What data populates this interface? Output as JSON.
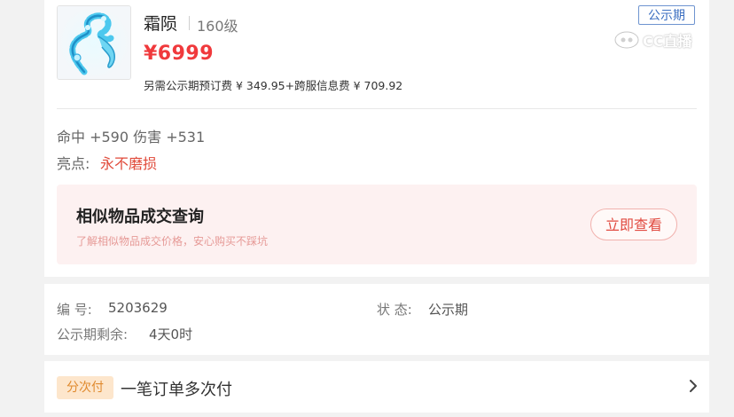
{
  "item": {
    "name": "霜陨",
    "level": "160级",
    "price": "¥6999",
    "fee_text": "另需公示期预订费 ¥ 349.95+跨服信息费 ¥ 709.92",
    "status_tag": "公示期",
    "stats": "命中 +590 伤害 +531",
    "highlight_label": "亮点:",
    "highlight_value": "永不磨损"
  },
  "similar": {
    "title": "相似物品成交查询",
    "subtitle": "了解相似物品成交价格，安心购买不踩坑",
    "button": "立即查看"
  },
  "info": {
    "id_label": "编 号:",
    "id_value": "5203629",
    "status_label": "状 态:",
    "status_value": "公示期",
    "remaining_label": "公示期剩余:",
    "remaining_value": "4天0时"
  },
  "payment": {
    "tag": "分次付",
    "text": "一笔订单多次付"
  },
  "watermark": {
    "text": "CC直播"
  },
  "colors": {
    "price": "#f0393c",
    "highlight": "#e04a3a",
    "status_tag": "#3c6fc1",
    "pay_tag_bg": "#fde6cc",
    "pay_tag_text": "#e08a2e"
  },
  "icons": {
    "item_image": "ice-chain-weapon-icon",
    "chevron": "chevron-right-icon",
    "watermark_logo": "cc-logo-icon"
  }
}
